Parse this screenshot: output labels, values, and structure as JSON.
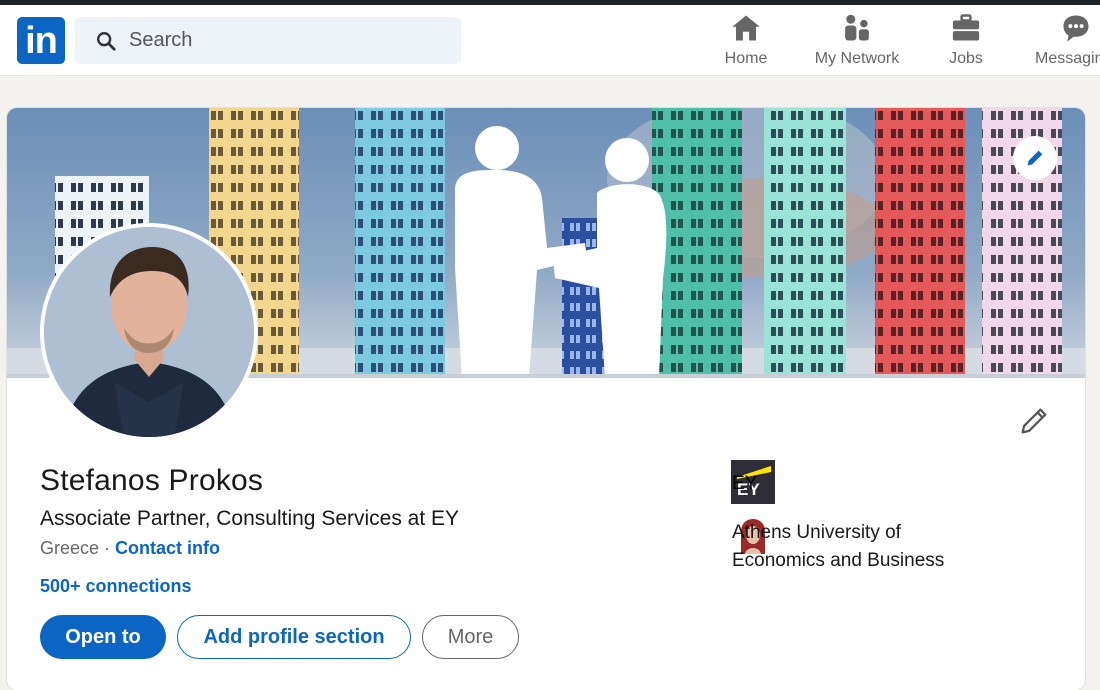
{
  "nav": {
    "logo_text": "in",
    "search_placeholder": "Search",
    "items": [
      {
        "label": "Home",
        "icon": "home-icon"
      },
      {
        "label": "My Network",
        "icon": "network-icon"
      },
      {
        "label": "Jobs",
        "icon": "briefcase-icon"
      },
      {
        "label": "Messaging",
        "icon": "messaging-icon"
      }
    ]
  },
  "profile": {
    "name": "Stefanos Prokos",
    "headline": "Associate Partner, Consulting Services at EY",
    "location": "Greece",
    "separator": " · ",
    "contact_info": "Contact info",
    "connections": "500+ connections",
    "buttons": {
      "open_to": "Open to",
      "add_section": "Add profile section",
      "more": "More"
    },
    "organizations": [
      {
        "name": "EY",
        "logo_text": "EY"
      },
      {
        "name_line1": "Athens University of",
        "name_line2": "Economics and Business"
      }
    ]
  },
  "colors": {
    "brand": "#0a66c2",
    "background": "#f4f2ee",
    "ey_yellow": "#ffe600"
  }
}
